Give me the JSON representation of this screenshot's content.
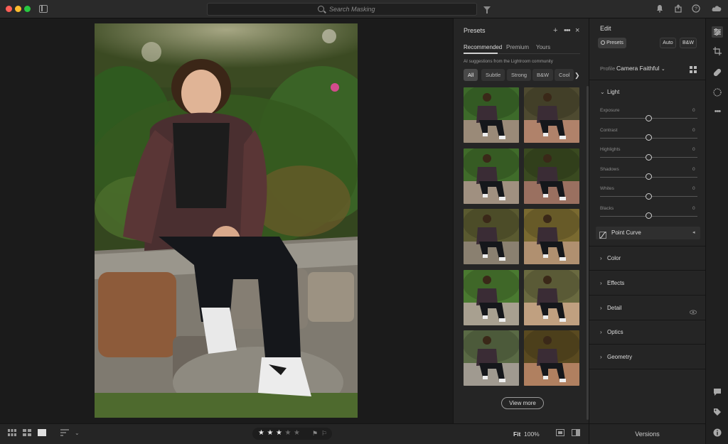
{
  "titlebar": {
    "search_placeholder": "Search Masking"
  },
  "presets": {
    "title": "Presets",
    "tabs": [
      "Recommended",
      "Premium",
      "Yours"
    ],
    "active_tab": "Recommended",
    "ai_note": "AI suggestions from the Lightroom community",
    "chips": [
      "All",
      "Subtle",
      "Strong",
      "B&W",
      "Cool"
    ],
    "active_chip": "All",
    "view_more": "View more",
    "thumbnail_count": 10
  },
  "edit": {
    "title": "Edit",
    "presets_button": "Presets",
    "auto_button": "Auto",
    "bw_button": "B&W",
    "profile_label": "Profile",
    "profile_value": "Camera Faithful",
    "light": {
      "title": "Light",
      "sliders": [
        {
          "label": "Exposure",
          "value": "0"
        },
        {
          "label": "Contrast",
          "value": "0"
        },
        {
          "label": "Highlights",
          "value": "0"
        },
        {
          "label": "Shadows",
          "value": "0"
        },
        {
          "label": "Whites",
          "value": "0"
        },
        {
          "label": "Blacks",
          "value": "0"
        }
      ],
      "point_curve": "Point Curve"
    },
    "sections": [
      "Color",
      "Effects",
      "Detail",
      "Optics",
      "Geometry"
    ]
  },
  "bottombar": {
    "rating": 3,
    "max_rating": 5,
    "fit": "Fit",
    "zoom": "100%",
    "versions": "Versions"
  },
  "colors": {
    "accent": "#d0d0d0",
    "panel": "#252525",
    "background": "#1b1b1b"
  }
}
